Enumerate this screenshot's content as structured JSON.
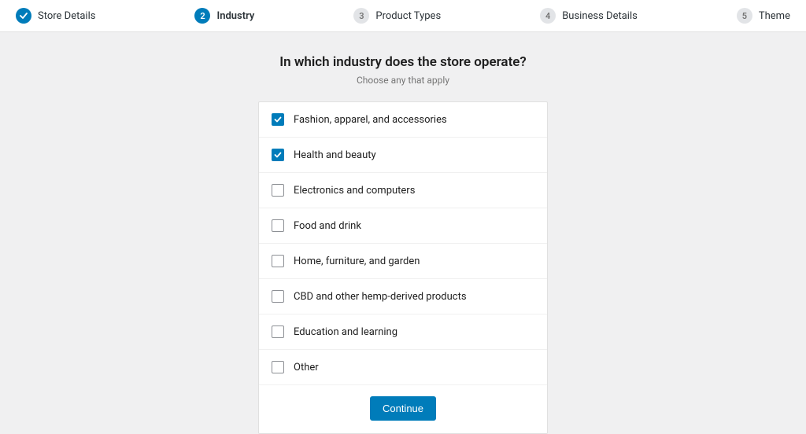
{
  "stepper": {
    "steps": [
      {
        "label": "Store Details",
        "state": "done"
      },
      {
        "label": "Industry",
        "state": "current",
        "number": "2"
      },
      {
        "label": "Product Types",
        "state": "pending",
        "number": "3"
      },
      {
        "label": "Business Details",
        "state": "pending",
        "number": "4"
      },
      {
        "label": "Theme",
        "state": "pending",
        "number": "5"
      }
    ]
  },
  "page": {
    "heading": "In which industry does the store operate?",
    "subheading": "Choose any that apply"
  },
  "options": [
    {
      "label": "Fashion, apparel, and accessories",
      "checked": true
    },
    {
      "label": "Health and beauty",
      "checked": true
    },
    {
      "label": "Electronics and computers",
      "checked": false
    },
    {
      "label": "Food and drink",
      "checked": false
    },
    {
      "label": "Home, furniture, and garden",
      "checked": false
    },
    {
      "label": "CBD and other hemp-derived products",
      "checked": false
    },
    {
      "label": "Education and learning",
      "checked": false
    },
    {
      "label": "Other",
      "checked": false
    }
  ],
  "actions": {
    "continue_label": "Continue"
  },
  "colors": {
    "primary": "#007cba",
    "muted": "#757575",
    "bg": "#f0f0f1"
  }
}
